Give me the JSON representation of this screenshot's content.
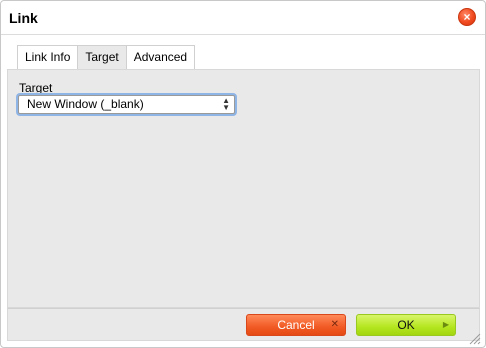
{
  "dialog": {
    "title": "Link",
    "close_icon": "close-icon"
  },
  "tabs": [
    {
      "label": "Link Info"
    },
    {
      "label": "Target"
    },
    {
      "label": "Advanced"
    }
  ],
  "active_tab": "Target",
  "target": {
    "label": "Target",
    "selected_value": "New Window (_blank)"
  },
  "buttons": {
    "cancel_label": "Cancel",
    "ok_label": "OK"
  },
  "colors": {
    "cancel": "#f15a24",
    "ok": "#b4e61f",
    "close": "#f04a1f",
    "panel": "#e9e9e9"
  }
}
